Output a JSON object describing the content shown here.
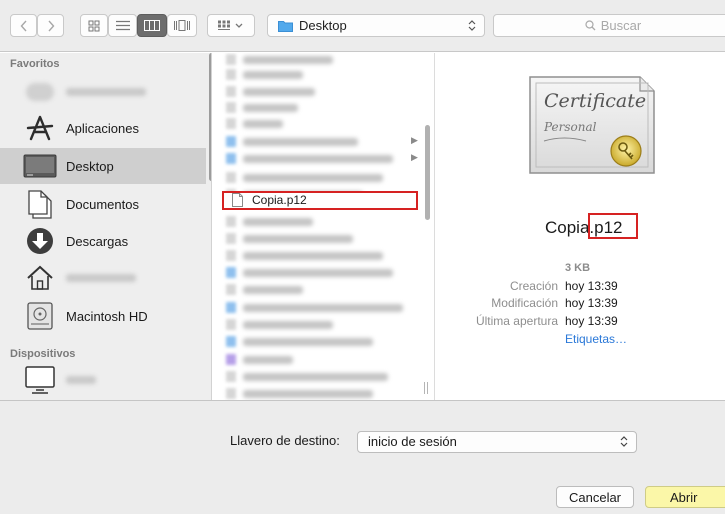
{
  "toolbar": {
    "location": "Desktop",
    "search_placeholder": "Buscar"
  },
  "sidebar": {
    "favorites_header": "Favoritos",
    "devices_header": "Dispositivos",
    "items": [
      {
        "label": "Aplicaciones",
        "icon": "applications-icon"
      },
      {
        "label": "Desktop",
        "icon": "desktop-icon",
        "selected": true
      },
      {
        "label": "Documentos",
        "icon": "documents-icon"
      },
      {
        "label": "Descargas",
        "icon": "downloads-icon"
      },
      {
        "label": "Macintosh HD",
        "icon": "hard-drive-icon"
      }
    ]
  },
  "files": {
    "selected": "Copia.p12"
  },
  "preview": {
    "name": "Copia.p12",
    "size": "3 KB",
    "meta": [
      {
        "label": "Creación",
        "value": "hoy 13:39"
      },
      {
        "label": "Modificación",
        "value": "hoy 13:39"
      },
      {
        "label": "Última apertura",
        "value": "hoy 13:39"
      }
    ],
    "tags": "Etiquetas…",
    "certificate_text": "Certificate",
    "certificate_sub": "Personal"
  },
  "bottom": {
    "keychain_label": "Llavero de destino:",
    "keychain_value": "inicio de sesión",
    "cancel": "Cancelar",
    "open": "Abrir"
  },
  "colors": {
    "highlight_box": "#d62222",
    "open_button": "#fbf7a8",
    "link": "#2a78d8"
  }
}
